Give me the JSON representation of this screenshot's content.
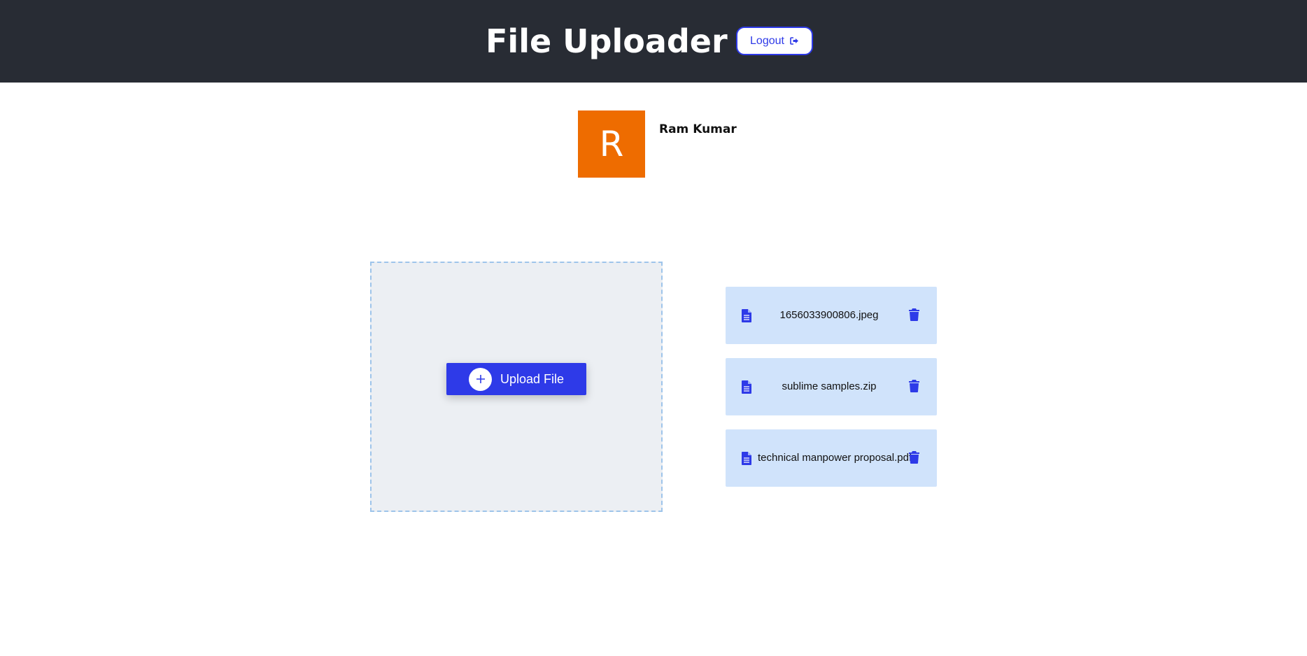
{
  "header": {
    "title": "File Uploader",
    "logout_label": "Logout",
    "logout_icon": "sign-out-icon",
    "background_color": "#282c34"
  },
  "user": {
    "avatar_initial": "R",
    "avatar_color": "#ee6c00",
    "name": "Ram Kumar"
  },
  "upload": {
    "button_label": "Upload File",
    "button_icon": "plus-circle-icon",
    "accent_color": "#2e3ae8"
  },
  "files": [
    {
      "name": "1656033900806.jpeg",
      "icon": "file-icon",
      "action_icon": "trash-icon"
    },
    {
      "name": "sublime samples.zip",
      "icon": "file-icon",
      "action_icon": "trash-icon"
    },
    {
      "name": "technical manpower proposal.pdf",
      "icon": "file-icon",
      "action_icon": "trash-icon"
    }
  ]
}
